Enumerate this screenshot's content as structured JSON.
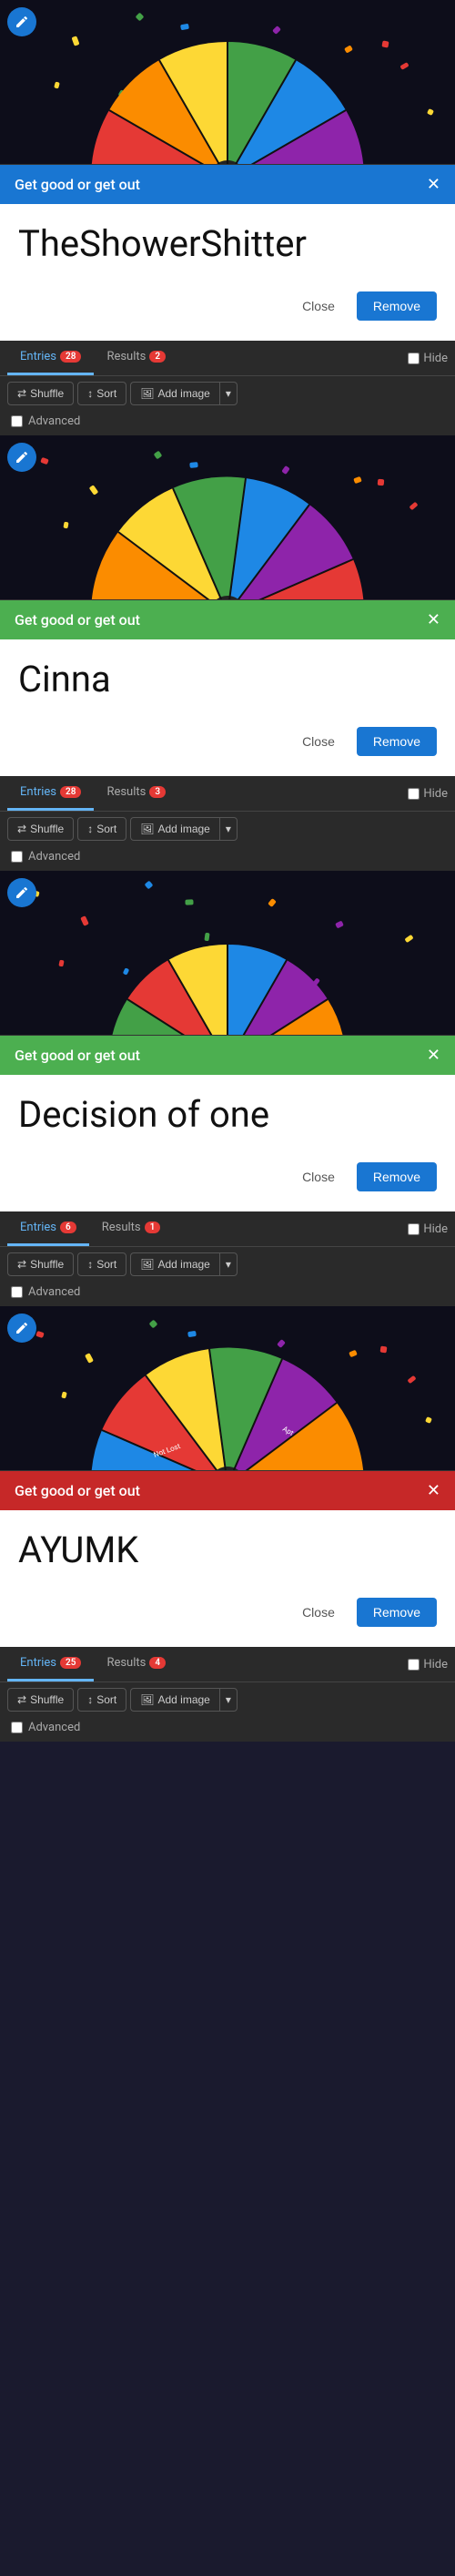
{
  "panels": [
    {
      "id": "panel1",
      "confetti_height": 180,
      "wheel_colors": [
        "#e53935",
        "#fb8c00",
        "#fdd835",
        "#43a047",
        "#1e88e5",
        "#8e24aa"
      ],
      "popup": {
        "header_text": "Get good or get out",
        "header_color": "blue",
        "name": "TheShowerShitter",
        "close_label": "Close",
        "remove_label": "Remove"
      },
      "tabs": {
        "entries_label": "Entries",
        "entries_count": "28",
        "results_label": "Results",
        "results_count": "2",
        "hide_label": "Hide"
      },
      "toolbar": {
        "shuffle_label": "Shuffle",
        "sort_label": "Sort",
        "add_image_label": "Add image"
      },
      "advanced_label": "Advanced"
    },
    {
      "id": "panel2",
      "confetti_height": 180,
      "popup": {
        "header_text": "Get good or get out",
        "header_color": "green",
        "name": "Cinna",
        "close_label": "Close",
        "remove_label": "Remove"
      },
      "tabs": {
        "entries_label": "Entries",
        "entries_count": "28",
        "results_label": "Results",
        "results_count": "3",
        "hide_label": "Hide"
      },
      "toolbar": {
        "shuffle_label": "Shuffle",
        "sort_label": "Sort",
        "add_image_label": "Add image"
      },
      "advanced_label": "Advanced"
    },
    {
      "id": "panel3",
      "confetti_height": 180,
      "popup": {
        "header_text": "Get good or get out",
        "header_color": "green",
        "name": "Decision of one",
        "close_label": "Close",
        "remove_label": "Remove"
      },
      "tabs": {
        "entries_label": "Entries",
        "entries_count": "6",
        "results_label": "Results",
        "results_count": "1",
        "hide_label": "Hide"
      },
      "toolbar": {
        "shuffle_label": "Shuffle",
        "sort_label": "Sort",
        "add_image_label": "Add image"
      },
      "advanced_label": "Advanced"
    },
    {
      "id": "panel4",
      "confetti_height": 180,
      "popup": {
        "header_text": "Get good or get out",
        "header_color": "red",
        "name": "AYUMK",
        "close_label": "Close",
        "remove_label": "Remove"
      },
      "tabs": {
        "entries_label": "Entries",
        "entries_count": "25",
        "results_label": "Results",
        "results_count": "4",
        "hide_label": "Hide"
      },
      "toolbar": {
        "shuffle_label": "Shuffle",
        "sort_label": "Sort",
        "add_image_label": "Add image"
      },
      "advanced_label": "Advanced"
    }
  ]
}
